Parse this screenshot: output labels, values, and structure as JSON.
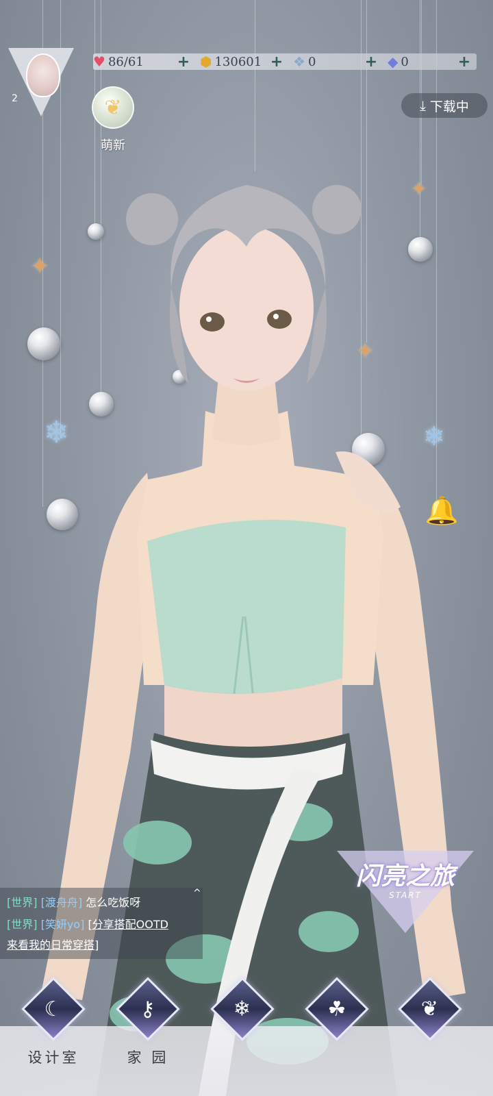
{
  "player": {
    "level": "2"
  },
  "resources": {
    "stamina": {
      "value": "86/61",
      "icon": "heart-gem-icon"
    },
    "gold": {
      "value": "130601",
      "icon": "gold-coin-icon"
    },
    "crystal": {
      "value": "0",
      "icon": "crystal-shard-icon"
    },
    "diamond": {
      "value": "0",
      "icon": "diamond-icon"
    }
  },
  "moe_badge": {
    "label": "萌新"
  },
  "download": {
    "label": "下载中"
  },
  "chat": {
    "messages": [
      {
        "channel": "[世界]",
        "user": "[渡舟舟]",
        "text": "怎么吃饭呀"
      },
      {
        "channel": "[世界]",
        "user": "[笑妍yo]",
        "text": "[分享搭配OOTD",
        "text2": "来看我的日常穿搭]"
      }
    ]
  },
  "journey": {
    "title": "闪亮之旅",
    "subtitle": "START"
  },
  "nav": [
    {
      "label": "设计室",
      "icon": "moon-key-icon"
    },
    {
      "label": "家 园",
      "icon": "key-icon"
    },
    {
      "label": "",
      "icon": "snowflake-gem-icon"
    },
    {
      "label": "",
      "icon": "clover-icon"
    },
    {
      "label": "",
      "icon": "butterfly-icon"
    }
  ],
  "colors": {
    "chat_channel": "#7fe0c4",
    "chat_user": "#8fd0ff",
    "plus": "#2d5f55"
  }
}
